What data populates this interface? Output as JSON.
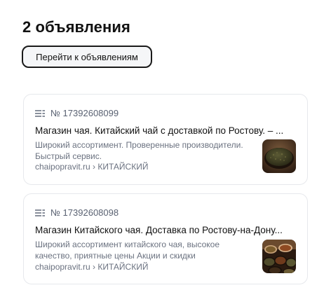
{
  "heading": "2 объявления",
  "goto_button": "Перейти к объявлениям",
  "ads": [
    {
      "number": "№ 17392608099",
      "title": "Магазин чая. Китайский чай с доставкой по Ростову. – ...",
      "description_line1": "Широкий ассортимент. Проверенные производители.",
      "description_line2": "Быстрый сервис.",
      "url": "chaipopravit.ru › КИТАЙСКИЙ",
      "thumb_icon": "loose-tea-bowl-image"
    },
    {
      "number": "№ 17392608098",
      "title": "Магазин Китайского чая. Доставка по Ростову-на-Дону...",
      "description_line1": "Широкий ассортимент китайского чая, высокое",
      "description_line2": "качество, приятные цены Акции и скидки",
      "url": "chaipopravit.ru › КИТАЙСКИЙ",
      "thumb_icon": "tea-bowls-assortment-image"
    }
  ],
  "colors": {
    "card_border": "#e6e8ec",
    "secondary_text": "#6b7280",
    "button_bg": "#f5f6f8"
  }
}
